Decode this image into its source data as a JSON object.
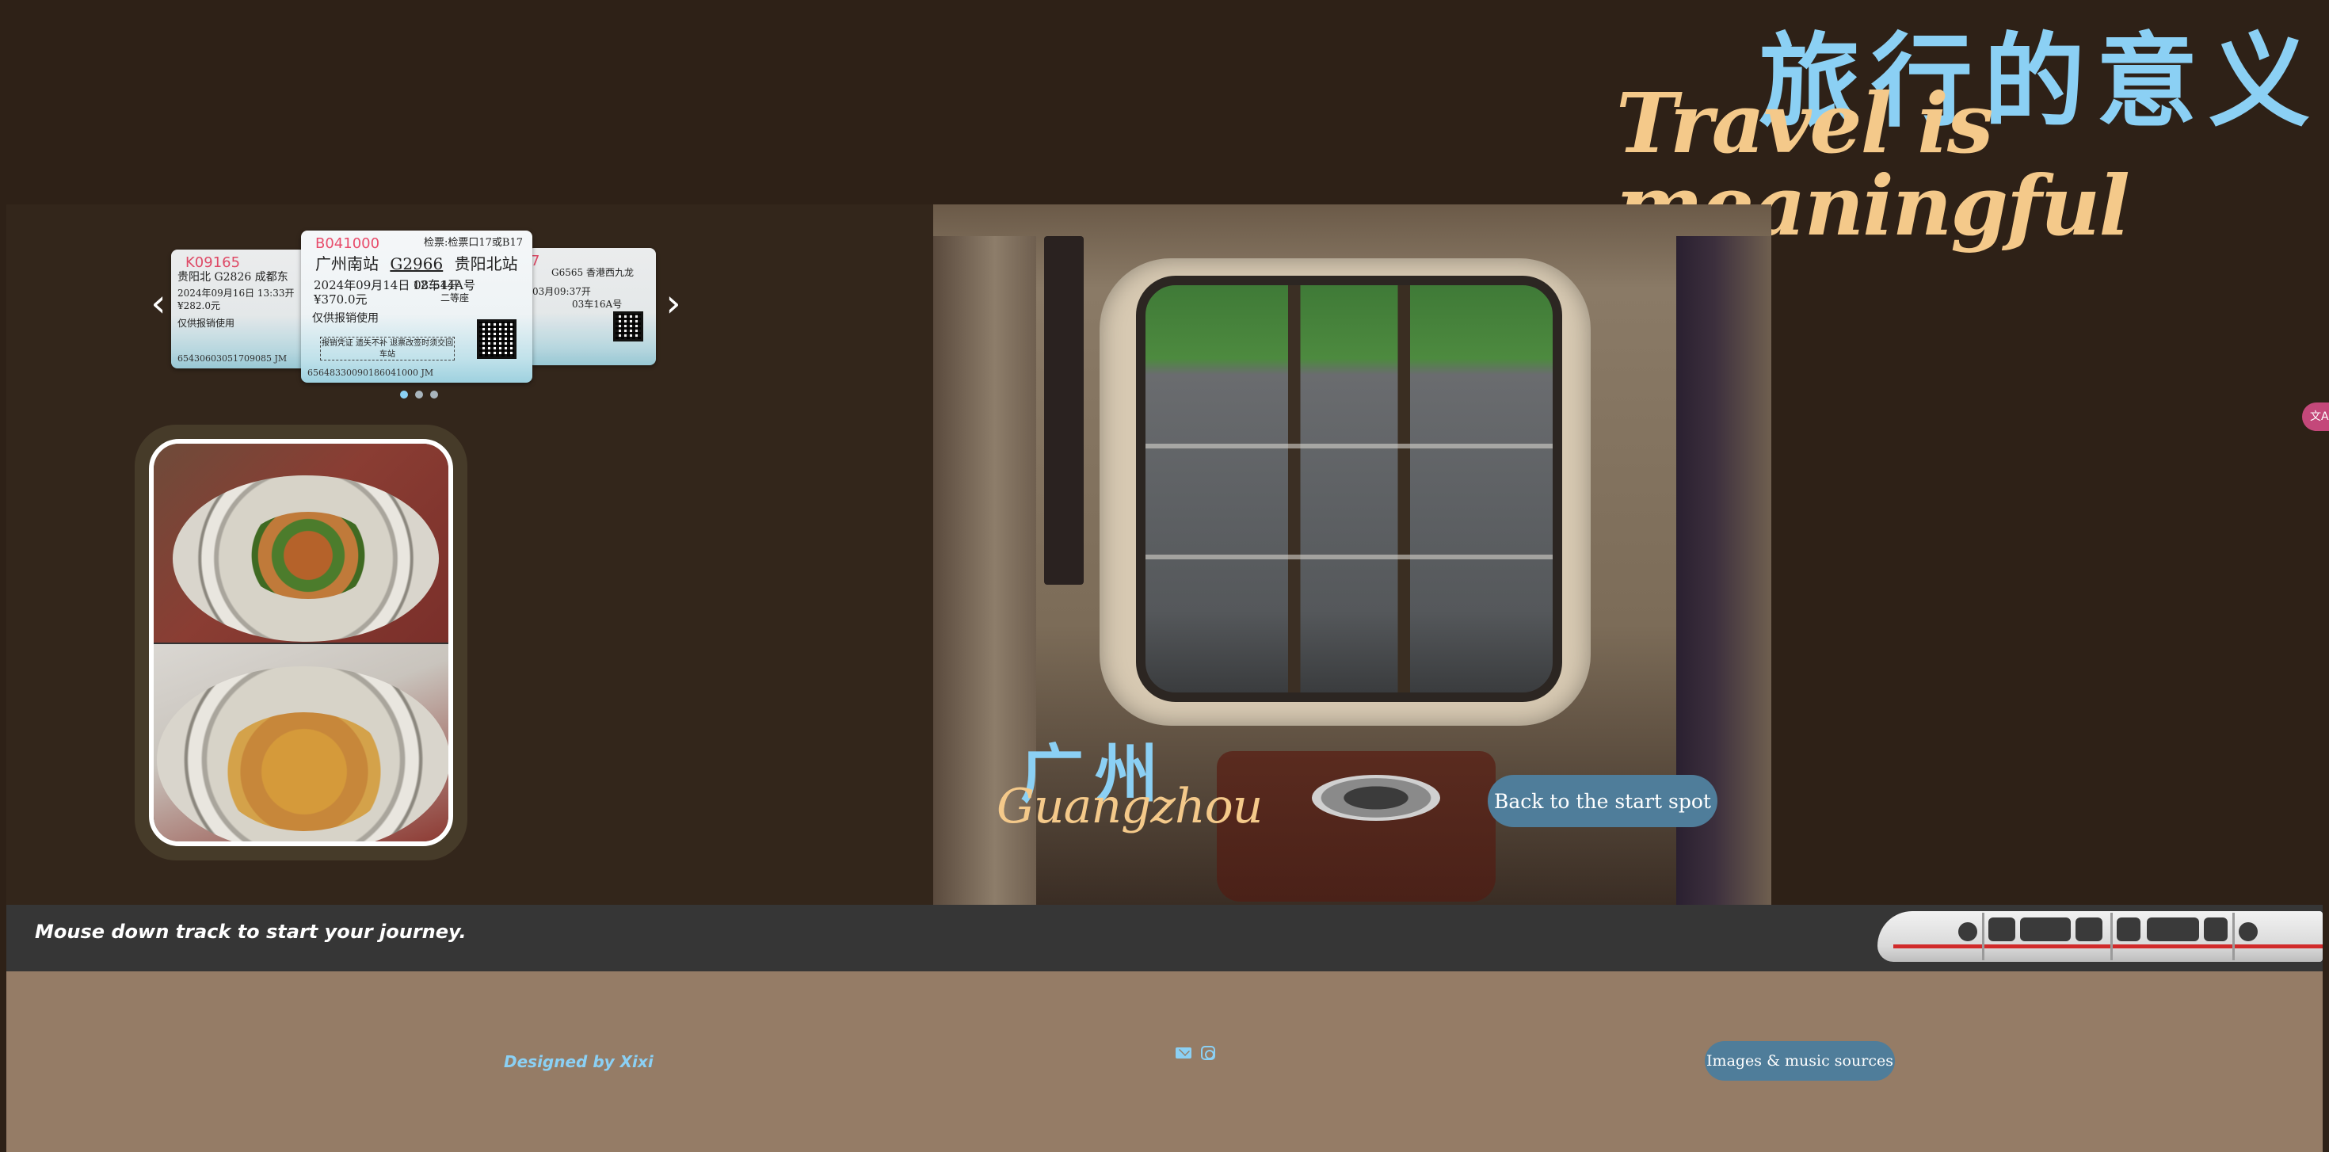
{
  "header": {
    "title_cn": "旅行的意义",
    "title_en": "Travel is meaningful"
  },
  "carousel": {
    "prev_icon": "chevron-left-icon",
    "next_icon": "chevron-right-icon",
    "prev_glyph": "‹",
    "next_glyph": "›",
    "active_index": 1,
    "dot_count": 3,
    "tickets": {
      "left": {
        "code": "K09165",
        "route": "贵阳北 G2826 成都东",
        "date": "2024年09月16日 13:33开",
        "price": "¥282.0元",
        "note": "仅供报销使用",
        "serial": "65430603051709085 JM"
      },
      "main": {
        "code": "B041000",
        "check": "检票:检票口17或B17",
        "from": "广州南站",
        "train_no": "G2966",
        "to": "贵阳北站",
        "date": "2024年09月14日 08:54开",
        "seat": "12车14A号",
        "price": "¥370.0元",
        "seat_class": "二等座",
        "note": "仅供报销使用",
        "box_text": "报销凭证 遗失不补 退票改签时须交回车站",
        "serial": "65648330090186041000 JM"
      },
      "right": {
        "code": "7",
        "route": "G6565 香港西九龙",
        "date": "03月09:37开",
        "seat": "03车16A号"
      }
    }
  },
  "food": {
    "top_alt": "stir-fried noodles with chives",
    "bottom_alt": "curry noodles"
  },
  "scene": {
    "city_cn": "广州",
    "city_en": "Guangzhou",
    "back_button": "Back to the start spot"
  },
  "lang_tab": "文A",
  "track": {
    "hint": "Mouse down track to start your journey."
  },
  "footer": {
    "designed_by": "Designed by Xixi",
    "mail_icon": "mail-icon",
    "instagram_icon": "instagram-icon",
    "sources_button": "Images & music sources"
  },
  "colors": {
    "background": "#2e2117",
    "accent_blue": "#8bd0f4",
    "accent_gold": "#f4c98a",
    "button": "#4f7d9a",
    "footer": "#957c66",
    "track": "#363636"
  }
}
